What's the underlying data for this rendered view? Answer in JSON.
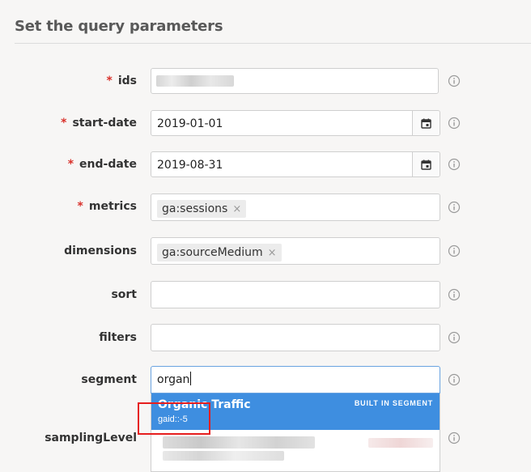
{
  "header": {
    "title": "Set the query parameters"
  },
  "fields": {
    "ids": {
      "label": "ids",
      "required": "*"
    },
    "start_date": {
      "label": "start-date",
      "required": "*",
      "value": "2019-01-01"
    },
    "end_date": {
      "label": "end-date",
      "required": "*",
      "value": "2019-08-31"
    },
    "metrics": {
      "label": "metrics",
      "required": "*",
      "chip": "ga:sessions",
      "chip_remove": "×"
    },
    "dimensions": {
      "label": "dimensions",
      "chip": "ga:sourceMedium",
      "chip_remove": "×"
    },
    "sort": {
      "label": "sort"
    },
    "filters": {
      "label": "filters"
    },
    "segment": {
      "label": "segment",
      "value": "organ"
    },
    "sampling_level": {
      "label": "samplingLevel"
    }
  },
  "segment_dropdown": {
    "active_item": {
      "name": "Organic Traffic",
      "badge": "BUILT IN SEGMENT",
      "id": "gaid::-5"
    }
  },
  "colors": {
    "accent": "#3e8ee0",
    "required": "#d9312b",
    "highlight": "#e61e1e"
  },
  "icons": {
    "info": "info-circle-icon",
    "calendar": "calendar-icon",
    "remove": "close-icon"
  }
}
